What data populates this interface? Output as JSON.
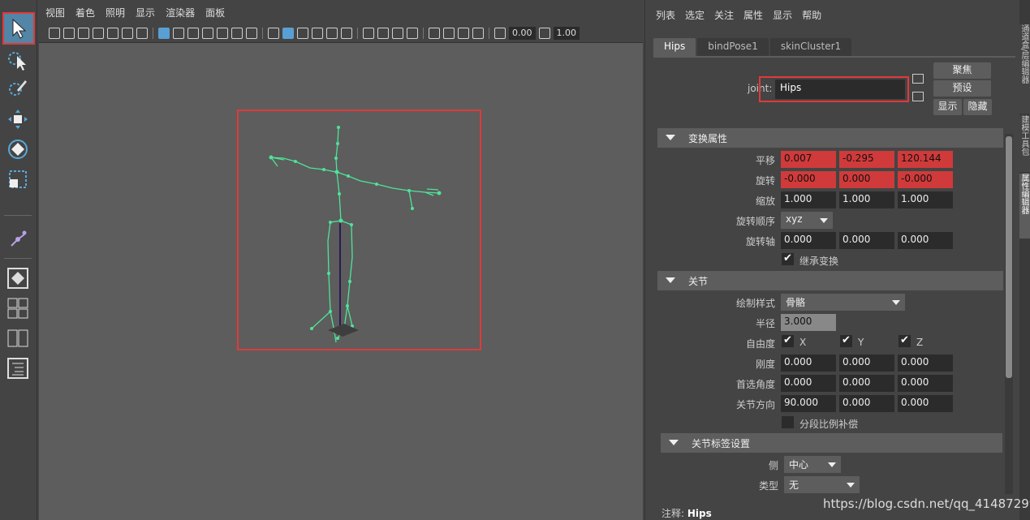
{
  "viewport": {
    "menu": [
      "视图",
      "着色",
      "照明",
      "显示",
      "渲染器",
      "面板"
    ],
    "field_1": "0.00",
    "field_2": "1.00"
  },
  "ae": {
    "menu": [
      "列表",
      "选定",
      "关注",
      "属性",
      "显示",
      "帮助"
    ],
    "tabs": [
      "Hips",
      "bindPose1",
      "skinCluster1"
    ],
    "joint_label": "joint:",
    "joint_name": "Hips",
    "buttons": {
      "focus": "聚焦",
      "preset": "预设",
      "show": "显示",
      "hide": "隐藏"
    },
    "transform": {
      "title": "变换属性",
      "translate_label": "平移",
      "translate": [
        "0.007",
        "-0.295",
        "120.144"
      ],
      "rotate_label": "旋转",
      "rotate": [
        "-0.000",
        "0.000",
        "-0.000"
      ],
      "scale_label": "缩放",
      "scale": [
        "1.000",
        "1.000",
        "1.000"
      ],
      "rotate_order_label": "旋转顺序",
      "rotate_order": "xyz",
      "rotate_axis_label": "旋转轴",
      "rotate_axis": [
        "0.000",
        "0.000",
        "0.000"
      ],
      "inherit_label": "继承变换"
    },
    "joint": {
      "title": "关节",
      "draw_style_label": "绘制样式",
      "draw_style": "骨骼",
      "radius_label": "半径",
      "radius": "3.000",
      "dof_label": "自由度",
      "dof": [
        "X",
        "Y",
        "Z"
      ],
      "stiffness_label": "刚度",
      "stiffness": [
        "0.000",
        "0.000",
        "0.000"
      ],
      "pref_angle_label": "首选角度",
      "pref_angle": [
        "0.000",
        "0.000",
        "0.000"
      ],
      "orient_label": "关节方向",
      "orient": [
        "90.000",
        "0.000",
        "0.000"
      ],
      "segment_label": "分段比例补偿"
    },
    "labeling": {
      "title": "关节标签设置",
      "side_label": "侧",
      "side": "中心",
      "type_label": "类型",
      "type": "无"
    },
    "notes_label": "注释:",
    "notes_value": "Hips"
  },
  "vtabs": [
    "通道盒/层编辑器",
    "建模工具包",
    "属性编辑器"
  ],
  "watermark": "https://blog.csdn.net/qq_41487299",
  "colors": {
    "accent": "#5285a6",
    "highlight_red": "#e03a3a",
    "keyed_red": "#d03a3a",
    "skeleton": "#4fe39a"
  }
}
